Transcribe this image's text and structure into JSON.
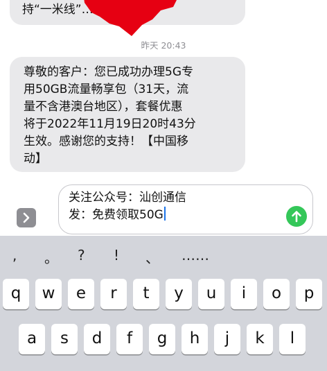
{
  "messages": {
    "top_bubble": "持“一米线”…………习惯。",
    "timestamp": "昨天 20:43",
    "main_bubble": "尊敬的客户：您已成功办理5G专\n用50GB流量畅享包（31天，流\n量不含港澳台地区），套餐优惠\n将于2022年11月19日20时43分\n生效。感谢您的支持！【中国移\n动】"
  },
  "compose": {
    "line1": "关注公众号：汕创通信",
    "line2": "发：免费领取50G"
  },
  "keyboard": {
    "punctuation": [
      ",",
      "。",
      "?",
      "!",
      "、",
      "……"
    ],
    "row1": [
      "q",
      "w",
      "e",
      "r",
      "t",
      "y",
      "u",
      "i",
      "o",
      "p"
    ],
    "row2": [
      "a",
      "s",
      "d",
      "f",
      "g",
      "h",
      "j",
      "k",
      "l"
    ]
  },
  "colors": {
    "bubble": "#e9e9eb",
    "send_button": "#34c759",
    "keyboard_bg": "#d3d5db",
    "redaction": "#e60012"
  },
  "icons": {
    "apps": "chevron-right-icon",
    "send": "arrow-up-icon"
  }
}
